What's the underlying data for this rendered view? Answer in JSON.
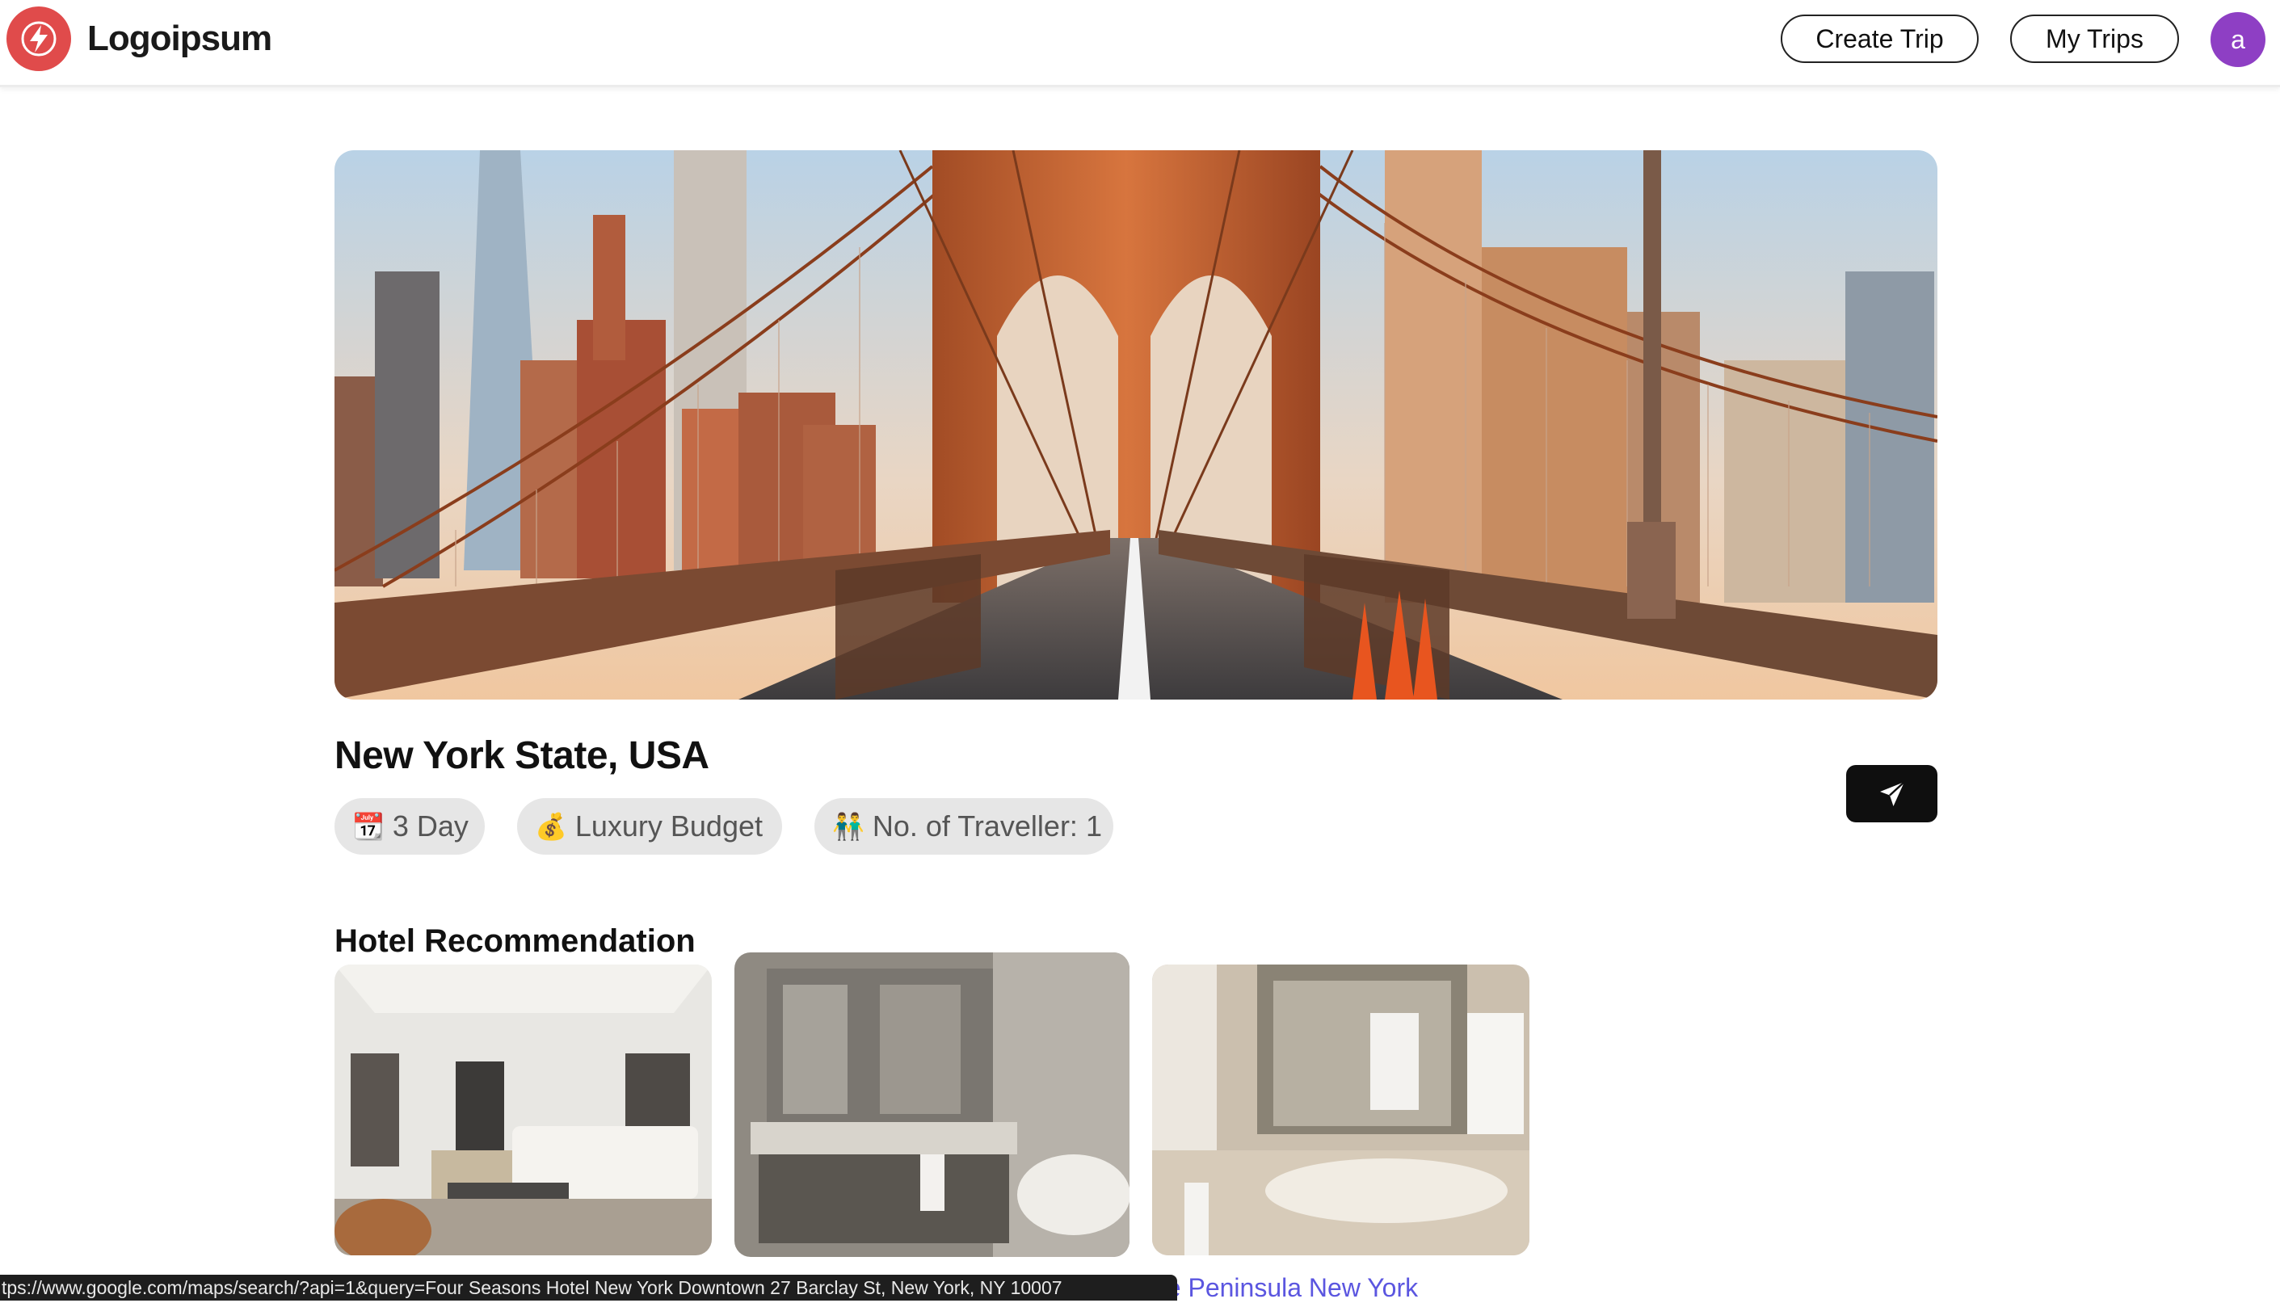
{
  "header": {
    "logo_text": "Logoipsum",
    "create_trip_label": "Create Trip",
    "my_trips_label": "My Trips",
    "avatar_initial": "a",
    "avatar_color": "#8e3fc4",
    "logo_color": "#e04b4b"
  },
  "trip": {
    "location": "New York State, USA",
    "chips": {
      "days": "3 Day",
      "budget": "Luxury Budget",
      "travellers": "No. of Traveller: 1"
    },
    "chip_icons": [
      "calendar-emoji",
      "money-bag-emoji",
      "people-emoji"
    ],
    "chip_emojis": [
      "📆",
      "💰",
      "👬"
    ]
  },
  "hotels": {
    "section_title": "Hotel Recommendation",
    "visible_name": "he Peninsula New York"
  },
  "status_bar": {
    "url": "tps://www.google.com/maps/search/?api=1&query=Four Seasons Hotel New York Downtown 27 Barclay St, New York, NY 10007"
  }
}
